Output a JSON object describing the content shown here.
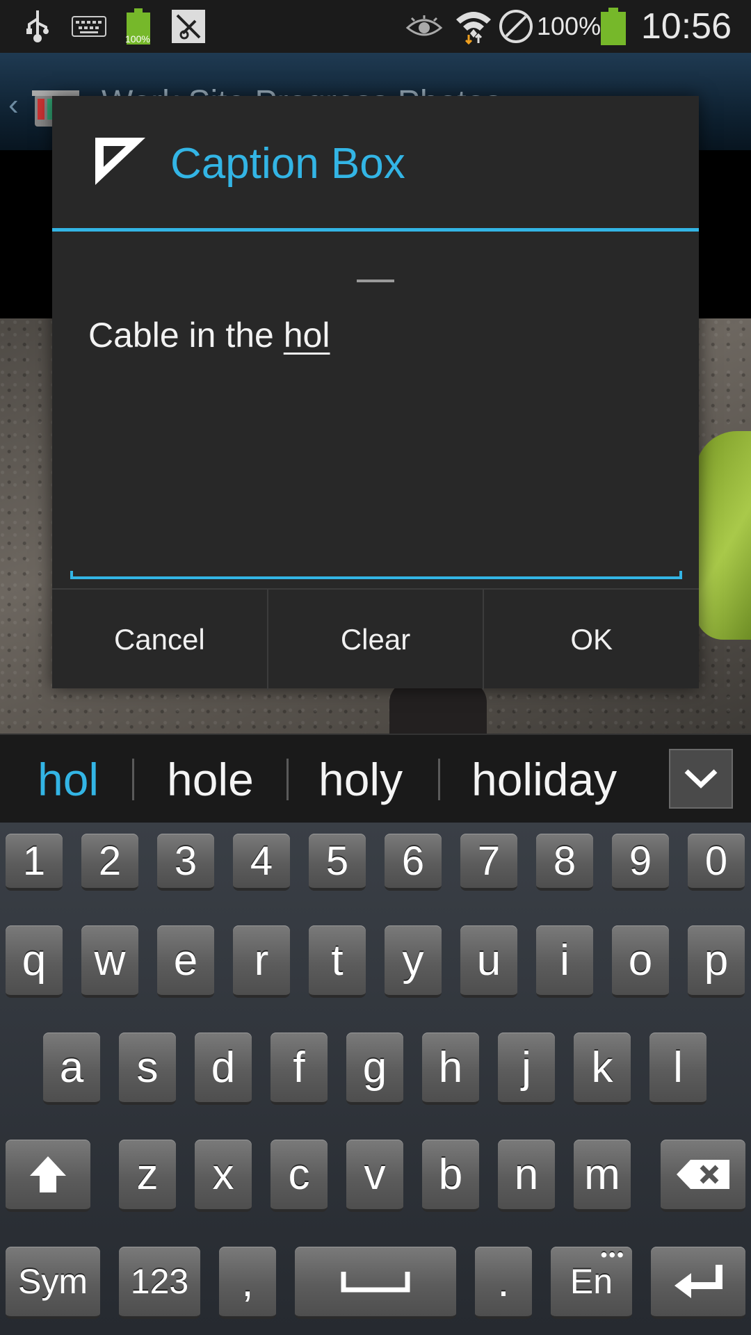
{
  "status_bar": {
    "time": "10:56",
    "battery_percent": "100%",
    "small_battery_label": "100%",
    "icons": [
      "usb-icon",
      "keyboard-icon",
      "battery-notification-icon",
      "app-notification-icon",
      "eye-icon",
      "wifi-icon",
      "blocked-icon",
      "battery-icon"
    ]
  },
  "background_app": {
    "title": "Work Site Progress Photos"
  },
  "dialog": {
    "title": "Caption Box",
    "caption_text": "Cable in the ",
    "caption_composing": "hol",
    "buttons": {
      "cancel": "Cancel",
      "clear": "Clear",
      "ok": "OK"
    }
  },
  "suggestions": {
    "items": [
      "hol",
      "hole",
      "holy",
      "holiday"
    ],
    "active_color": "#33b5e5"
  },
  "keyboard": {
    "number_row": [
      "1",
      "2",
      "3",
      "4",
      "5",
      "6",
      "7",
      "8",
      "9",
      "0"
    ],
    "row1": [
      "q",
      "w",
      "e",
      "r",
      "t",
      "y",
      "u",
      "i",
      "o",
      "p"
    ],
    "row2": [
      "a",
      "s",
      "d",
      "f",
      "g",
      "h",
      "j",
      "k",
      "l"
    ],
    "row3": [
      "z",
      "x",
      "c",
      "v",
      "b",
      "n",
      "m"
    ],
    "sym": "Sym",
    "num": "123",
    "comma": ",",
    "period": ".",
    "lang": "En"
  },
  "colors": {
    "accent": "#33b5e5"
  }
}
